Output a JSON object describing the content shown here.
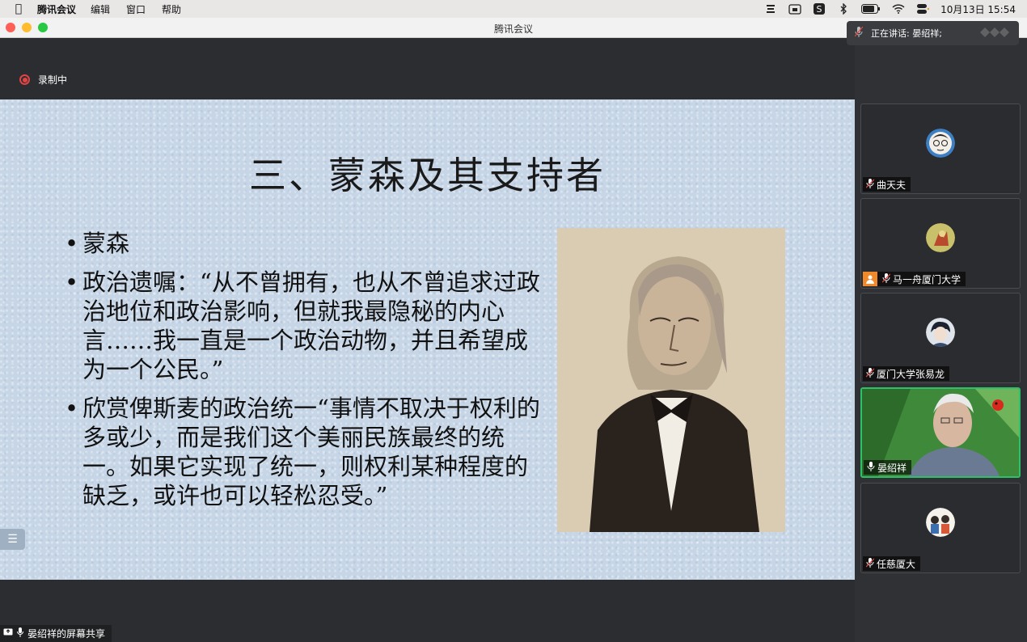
{
  "menubar": {
    "app_name": "腾讯会议",
    "items": [
      "编辑",
      "窗口",
      "帮助"
    ],
    "clock": "10月13日  15:54"
  },
  "window": {
    "title": "腾讯会议"
  },
  "recording": {
    "label": "录制中",
    "color": "#e04444"
  },
  "speaking": {
    "label": "正在讲话: 晏绍祥;"
  },
  "slide": {
    "title": "三、蒙森及其支持者",
    "bullets": [
      "蒙森",
      "政治遗嘱：“从不曾拥有，也从不曾追求过政治地位和政治影响，但就我最隐秘的内心言……我一直是一个政治动物，并且希望成为一个公民。”",
      "欣赏俾斯麦的政治统一“事情不取决于权利的多或少，而是我们这个美丽民族最终的统一。如果它实现了统一，则权利某种程度的缺乏，或许也可以轻松忍受。”"
    ]
  },
  "share_label": "晏绍祥的屏幕共享",
  "participants": [
    {
      "name": "曲天夫",
      "muted": true,
      "host": false,
      "video": false
    },
    {
      "name": "马一舟厦门大学",
      "muted": true,
      "host": true,
      "video": false
    },
    {
      "name": "厦门大学张易龙",
      "muted": true,
      "host": false,
      "video": false
    },
    {
      "name": "晏绍祥",
      "muted": false,
      "host": false,
      "video": true,
      "speaking": true
    },
    {
      "name": "任慈厦大",
      "muted": true,
      "host": false,
      "video": false
    }
  ],
  "colors": {
    "active_speaker_border": "#2fc06a",
    "host_badge": "#f0892a"
  }
}
